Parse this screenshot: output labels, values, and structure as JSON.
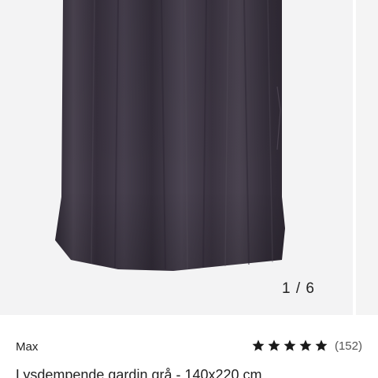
{
  "gallery": {
    "image_alt": "Lysdempende gardin grå",
    "counter": "1 / 6",
    "current": 1,
    "total": 6
  },
  "product": {
    "brand": "Max",
    "title": "Lysdempende gardin grå - 140x220 cm",
    "rating": {
      "stars": 5,
      "max_stars": 5,
      "reviews_label": "(152)"
    }
  },
  "colors": {
    "fabric": "#3a3440",
    "gallery_bg": "#f2f2f3",
    "text": "#222222",
    "star": "#1a1a1a"
  },
  "icons": [
    "star-icon"
  ]
}
